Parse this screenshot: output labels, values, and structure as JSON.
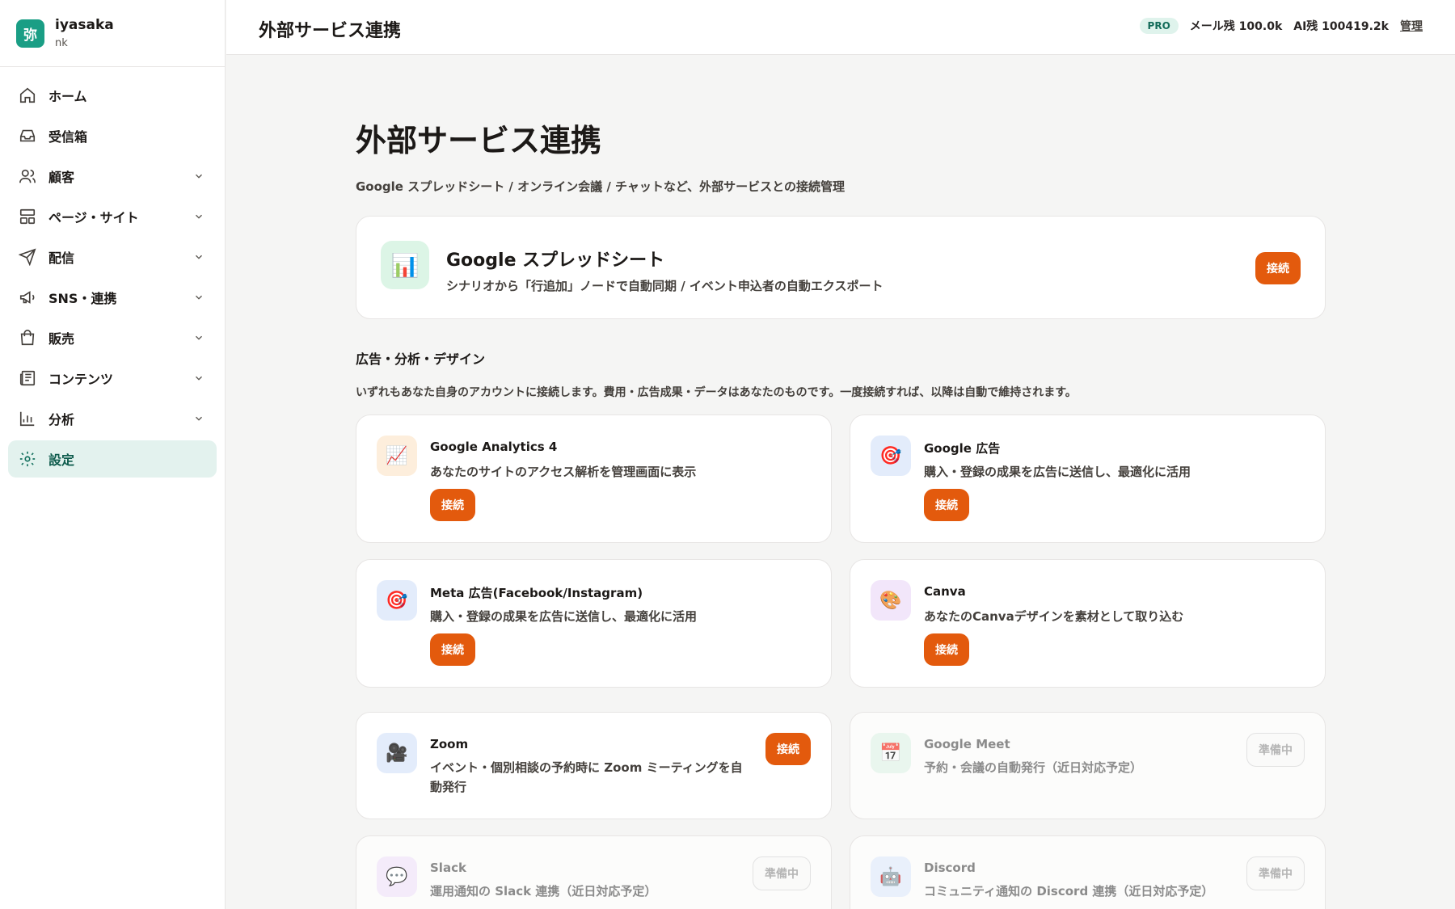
{
  "brand": {
    "avatar_char": "弥",
    "name": "iyasaka",
    "sub": "nk"
  },
  "sidebar": {
    "items": [
      {
        "label": "ホーム",
        "icon": "home-icon",
        "chevron": false,
        "active": false
      },
      {
        "label": "受信箱",
        "icon": "inbox-icon",
        "chevron": false,
        "active": false
      },
      {
        "label": "顧客",
        "icon": "users-icon",
        "chevron": true,
        "active": false
      },
      {
        "label": "ページ・サイト",
        "icon": "layout-icon",
        "chevron": true,
        "active": false
      },
      {
        "label": "配信",
        "icon": "send-icon",
        "chevron": true,
        "active": false
      },
      {
        "label": "SNS・連携",
        "icon": "megaphone-icon",
        "chevron": true,
        "active": false
      },
      {
        "label": "販売",
        "icon": "shopping-bag-icon",
        "chevron": true,
        "active": false
      },
      {
        "label": "コンテンツ",
        "icon": "newspaper-icon",
        "chevron": true,
        "active": false
      },
      {
        "label": "分析",
        "icon": "bar-chart-icon",
        "chevron": true,
        "active": false
      },
      {
        "label": "設定",
        "icon": "gear-icon",
        "chevron": false,
        "active": true
      }
    ]
  },
  "header": {
    "title": "外部サービス連携",
    "badge": "PRO",
    "mail_remaining": "メール残 100.0k",
    "ai_remaining": "AI残 100419.2k",
    "manage_label": "管理"
  },
  "main": {
    "title": "外部サービス連携",
    "description": "Google スプレッドシート / オンライン会議 / チャットなど、外部サービスとの接続管理",
    "sheets": {
      "title": "Google スプレッドシート",
      "description": "シナリオから「行追加」ノードで自動同期 / イベント申込者の自動エクスポート",
      "button": "接続",
      "icon": "📊"
    },
    "ads_section": {
      "title": "広告・分析・デザイン",
      "description": "いずれもあなた自身のアカウントに接続します。費用・広告成果・データはあなたのものです。一度接続すれば、以降は自動で維持されます。",
      "cards": [
        {
          "title": "Google Analytics 4",
          "description": "あなたのサイトのアクセス解析を管理画面に表示",
          "button": "接続",
          "icon": "📈",
          "icon_bg": "#fdeedc"
        },
        {
          "title": "Google 広告",
          "description": "購入・登録の成果を広告に送信し、最適化に活用",
          "button": "接続",
          "icon": "🎯",
          "icon_bg": "#e3ecfb"
        },
        {
          "title": "Meta 広告(Facebook/Instagram)",
          "description": "購入・登録の成果を広告に送信し、最適化に活用",
          "button": "接続",
          "icon": "🎯",
          "icon_bg": "#e3ecfb"
        },
        {
          "title": "Canva",
          "description": "あなたのCanvaデザインを素材として取り込む",
          "button": "接続",
          "icon": "🎨",
          "icon_bg": "#f2e6fa"
        }
      ]
    },
    "other_section": {
      "cards": [
        {
          "title": "Zoom",
          "description": "イベント・個別相談の予約時に Zoom ミーティングを自動発行",
          "button": "接続",
          "status": "connect",
          "icon": "🎥",
          "icon_bg": "#e3ecfb"
        },
        {
          "title": "Google Meet",
          "description": "予約・会議の自動発行（近日対応予定）",
          "button": "準備中",
          "status": "pending",
          "icon": "📅",
          "icon_bg": "#e3f5ea"
        },
        {
          "title": "Slack",
          "description": "運用通知の Slack 連携（近日対応予定）",
          "button": "準備中",
          "status": "pending",
          "icon": "💬",
          "icon_bg": "#f2e6fa"
        },
        {
          "title": "Discord",
          "description": "コミュニティ通知の Discord 連携（近日対応予定）",
          "button": "準備中",
          "status": "pending",
          "icon": "🤖",
          "icon_bg": "#e3ecfb"
        }
      ]
    }
  },
  "colors": {
    "accent": "#e35a0d",
    "brand": "#1a9e85",
    "active_bg": "#e3f2ee"
  }
}
